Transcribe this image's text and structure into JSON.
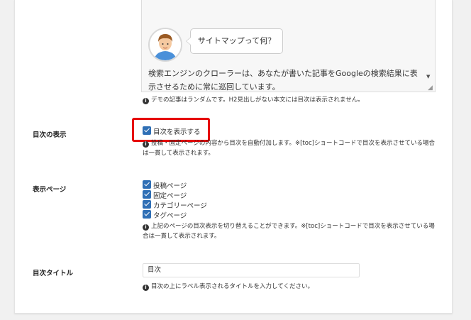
{
  "demo": {
    "question": "サイトマップって何？",
    "body": "検索エンジンのクローラーは、あなたが書いた記事をGoogleの検索結果に表示させるために常に巡回しています。",
    "note": "デモの記事はランダムです。H2見出しがない本文には目次は表示されません。"
  },
  "toc_display": {
    "label": "目次の表示",
    "checkbox_label": "目次を表示する",
    "checked": true,
    "note": "投稿・固定ページの内容から目次を自動付加します。※[toc]ショートコードで目次を表示させている場合は一貫して表示されます。"
  },
  "display_pages": {
    "label": "表示ページ",
    "options": [
      {
        "label": "投稿ページ",
        "checked": true
      },
      {
        "label": "固定ページ",
        "checked": true
      },
      {
        "label": "カテゴリーページ",
        "checked": true
      },
      {
        "label": "タグページ",
        "checked": true
      }
    ],
    "note": "上記のページの目次表示を切り替えることができます。※[toc]ショートコードで目次を表示させている場合は一貫して表示されます。"
  },
  "toc_title": {
    "label": "目次タイトル",
    "value": "目次",
    "note": "目次の上にラベル表示されるタイトルを入力してください。"
  },
  "colors": {
    "highlight": "#e60000",
    "checkbox": "#2f6fb5"
  }
}
